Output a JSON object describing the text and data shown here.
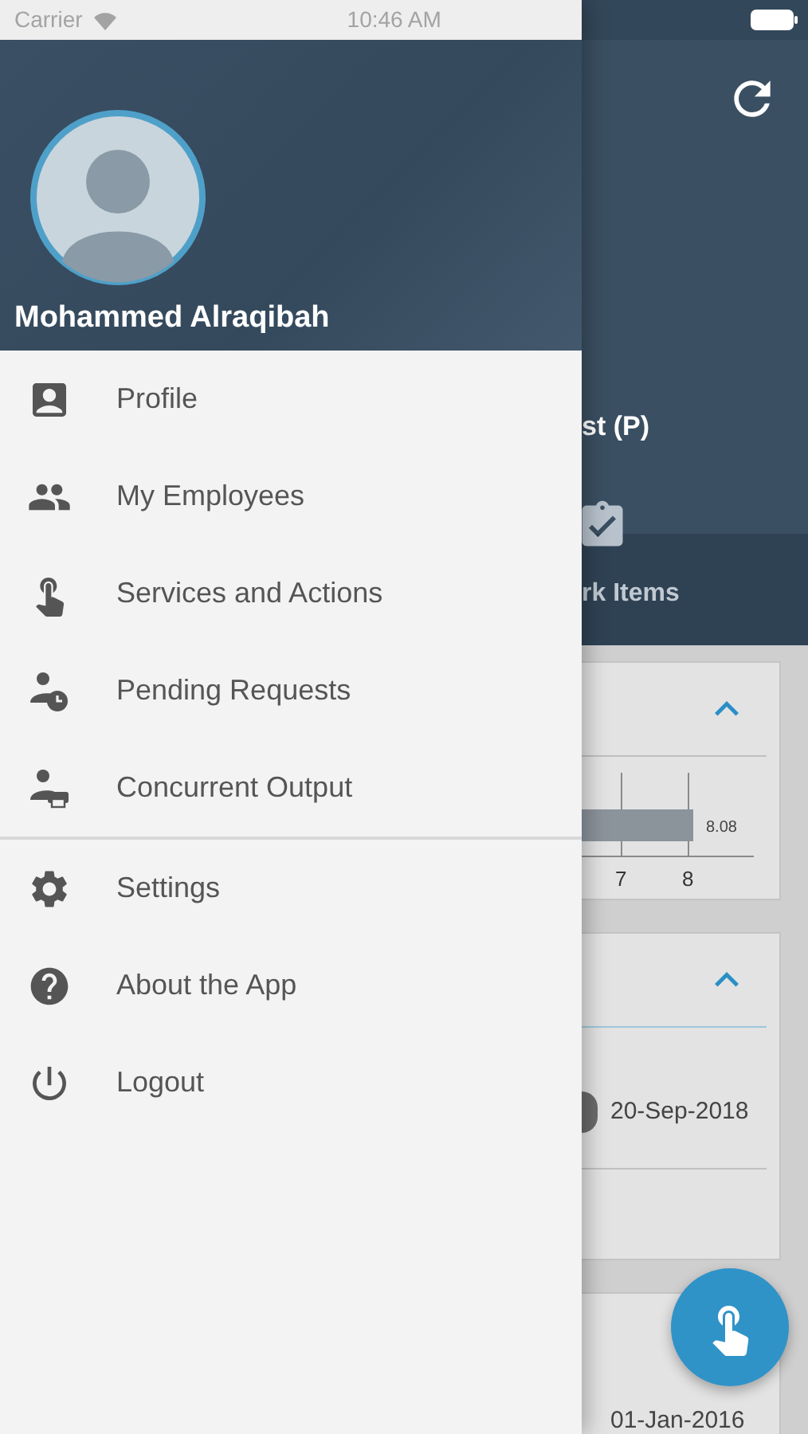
{
  "status_bar": {
    "carrier": "Carrier",
    "time": "10:46 AM"
  },
  "drawer": {
    "user_name": "Mohammed Alraqibah",
    "sections": [
      {
        "items": [
          {
            "label": "Profile",
            "kind": "profile"
          },
          {
            "label": "My Employees",
            "kind": "employees"
          },
          {
            "label": "Services and Actions",
            "kind": "services"
          },
          {
            "label": "Pending Requests",
            "kind": "pending"
          },
          {
            "label": "Concurrent Output",
            "kind": "output"
          }
        ]
      },
      {
        "items": [
          {
            "label": "Settings",
            "kind": "settings"
          },
          {
            "label": "About the App",
            "kind": "about"
          },
          {
            "label": "Logout",
            "kind": "logout"
          }
        ]
      }
    ]
  },
  "background": {
    "job_title": "st (P)",
    "tab_label": "rk Items",
    "accruals_card": {
      "expanded": true,
      "bar_label": "8.08",
      "ticks": [
        "7",
        "8"
      ]
    },
    "leave_card": {
      "expanded": true,
      "date": "20-Sep-2018"
    },
    "appraisal_card": {
      "date": "01-Jan-2016"
    }
  }
}
